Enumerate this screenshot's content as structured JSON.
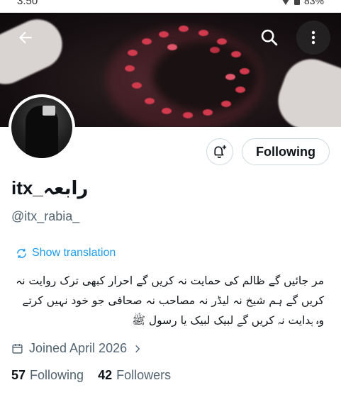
{
  "status_bar": {
    "time": "3:50",
    "battery": "83%"
  },
  "profile": {
    "display_name": "itx_رابعہ",
    "handle": "@itx_rabia_",
    "follow_state_label": "Following",
    "show_translation": "Show translation",
    "bio_lines": [
      "مر جائیں گے ظالم کی حمایت نہ کریں گے احرار کبھی ترک روایت نہ",
      "کریں گے ہم شیخ نہ لیڈر نہ مصاحب نہ صحافی جو خود نہیں کرتے",
      "وہ ہدایت نہ کریں گے لبیک لبیک یا رسول ﷺ"
    ],
    "joined": "Joined April 2026",
    "following_count": "57",
    "following_label": "Following",
    "followers_count": "42",
    "followers_label": "Followers"
  },
  "icons": {
    "back": "arrow-left-icon",
    "search": "search-icon",
    "more": "more-vertical-icon",
    "bell": "bell-plus-icon",
    "translate": "translate-icon",
    "calendar": "calendar-icon",
    "chevron": "chevron-right-icon"
  },
  "colors": {
    "accent": "#1d9bf0",
    "secondary_text": "#536471",
    "primary_text": "#0f1419"
  }
}
